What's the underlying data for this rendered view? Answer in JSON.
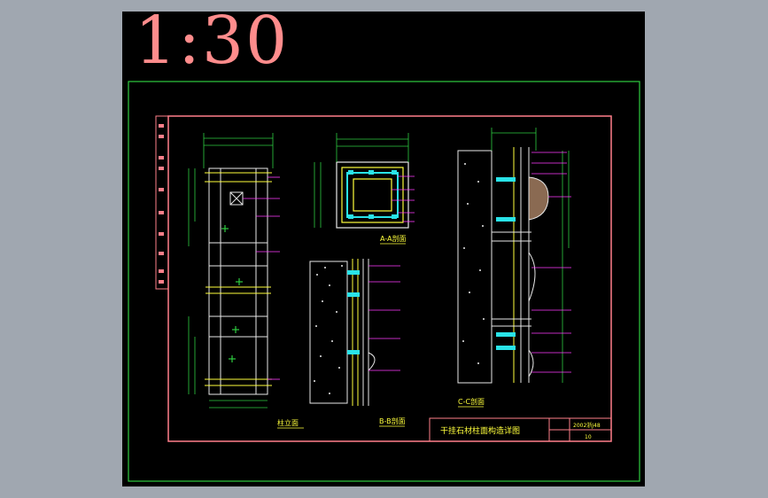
{
  "drawing": {
    "scale": "1:30",
    "title": "干挂石材柱面构造详图",
    "atlas_no": "2002浙J48",
    "page_no": "10"
  },
  "views": {
    "column_elevation": "柱立面",
    "section_aa": "A-A剖面",
    "section_bb": "B-B剖面",
    "section_cc": "C-C剖面"
  },
  "colors": {
    "page_bg": "#a0a7b0",
    "sheet_bg": "#000000",
    "border_green": "#2ecc40",
    "border_pink": "#ff7f8a",
    "cyan": "#29e3e8",
    "magenta": "#ff3cff",
    "yellow": "#ffff3c",
    "white": "#e8e8e8"
  }
}
